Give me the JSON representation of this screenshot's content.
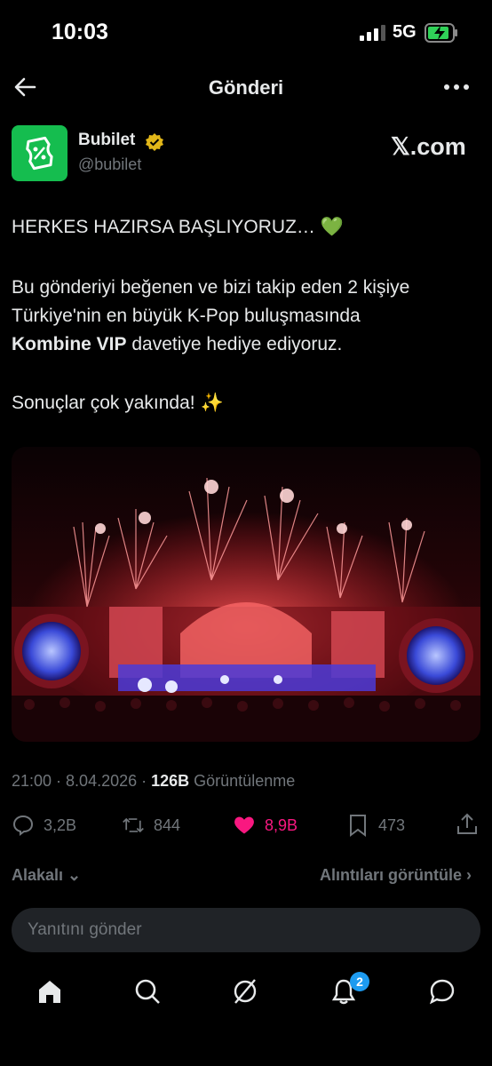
{
  "status_bar": {
    "time": "10:03",
    "network": "5G"
  },
  "header": {
    "title": "Gönderi",
    "back_icon": "arrow-left-icon",
    "more_icon": "more-dots-icon"
  },
  "author": {
    "name": "Bubilet",
    "handle": "@bubilet",
    "verified": true,
    "source_label": "𝕏.com"
  },
  "tweet": {
    "line1": "HERKES HAZIRSA BAŞLIYORUZ… 💚",
    "line2": "Bu gönderiyi beğenen ve bizi takip eden 2 kişiye",
    "line3": "Türkiye'nin en büyük K-Pop buluşmasında",
    "line4_bold": "Kombine VIP",
    "line4_rest": " davetiye hediye ediyoruz.",
    "line5": "Sonuçlar çok yakında! ✨",
    "image_icon": "concert-stage-photo"
  },
  "meta": {
    "time": "21:00 · 8.04.2026 · ",
    "views": "126B",
    "views_label": " Görüntülenme"
  },
  "actions": {
    "replies": "3,2B",
    "reposts": "844",
    "likes": "8,9B",
    "bookmarks": "473"
  },
  "related": {
    "label": "Alakalı ⌄",
    "quotes_label": "Alıntıları görüntüle ›"
  },
  "reply": {
    "placeholder": "Yanıtını gönder"
  },
  "nav": {
    "notifications_badge": "2"
  },
  "colors": {
    "accent": "#1d9bf0",
    "like": "#f91880",
    "brand": "#15bd4f"
  }
}
